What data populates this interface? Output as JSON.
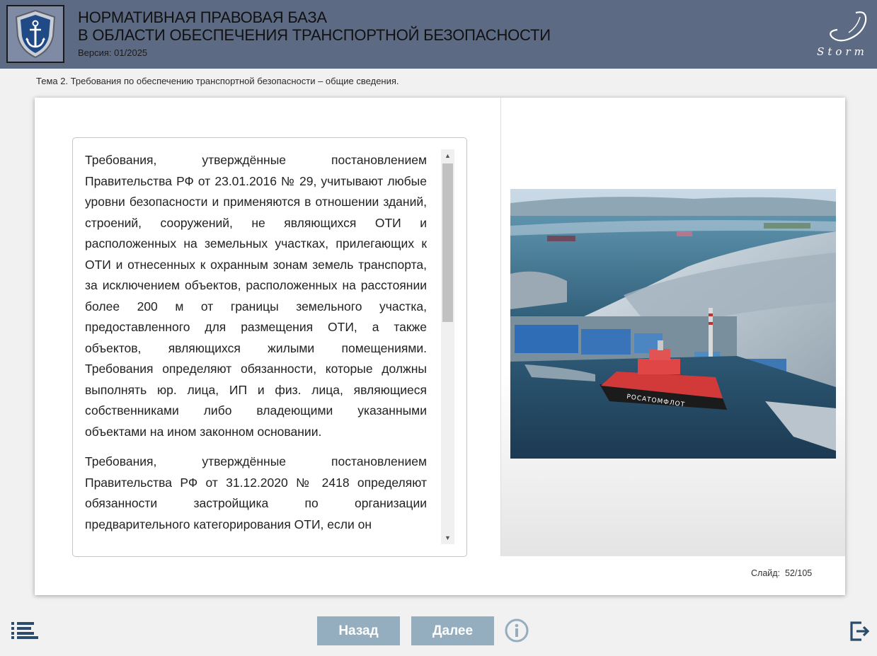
{
  "header": {
    "title_line1": "НОРМАТИВНАЯ ПРАВОВАЯ БАЗА",
    "title_line2": "В ОБЛАСТИ ОБЕСПЕЧЕНИЯ ТРАНСПОРТНОЙ БЕЗОПАСНОСТИ",
    "version": "Версия: 01/2025",
    "logo_icon": "anchor-shield-icon",
    "brand_name": "Storm"
  },
  "topic": "Тема 2. Требования по обеспечению транспортной безопасности – общие сведения.",
  "content": {
    "paragraphs": [
      "Требования, утверждённые постановлением Правительства РФ от 23.01.2016 № 29, учитывают любые уровни безопасности и применяются в отношении зданий, строений, сооружений, не являющихся ОТИ и расположенных на земельных участках, прилегающих к ОТИ и отнесенных к охранным зонам земель транспорта, за исключением объектов, расположенных на расстоянии более 200 м от границы земельного участка, предоставленного для размещения ОТИ, а также объектов, являющихся жилыми помещениями. Требования определяют обязанности, которые должны выполнять юр. лица, ИП и физ. лица, являющиеся собственниками либо владеющими указанными объектами на ином законном основании.",
      "Требования, утверждённые постановлением Правительства РФ от 31.12.2020 № 2418 определяют обязанности застройщика по организации предварительного категорирования ОТИ, если он"
    ]
  },
  "photo": {
    "icon": "port-icebreaker-image",
    "ship_name": "РОСАТОМФЛОТ"
  },
  "slide_counter": {
    "label": "Слайд:",
    "value": "52/105"
  },
  "nav": {
    "back_label": "Назад",
    "next_label": "Далее",
    "menu_icon": "menu-list-icon",
    "info_icon": "info-icon",
    "exit_icon": "exit-icon"
  },
  "colors": {
    "header_bg": "#5d6a84",
    "button_bg": "#95aebf",
    "page_bg": "#f1f1f1"
  }
}
